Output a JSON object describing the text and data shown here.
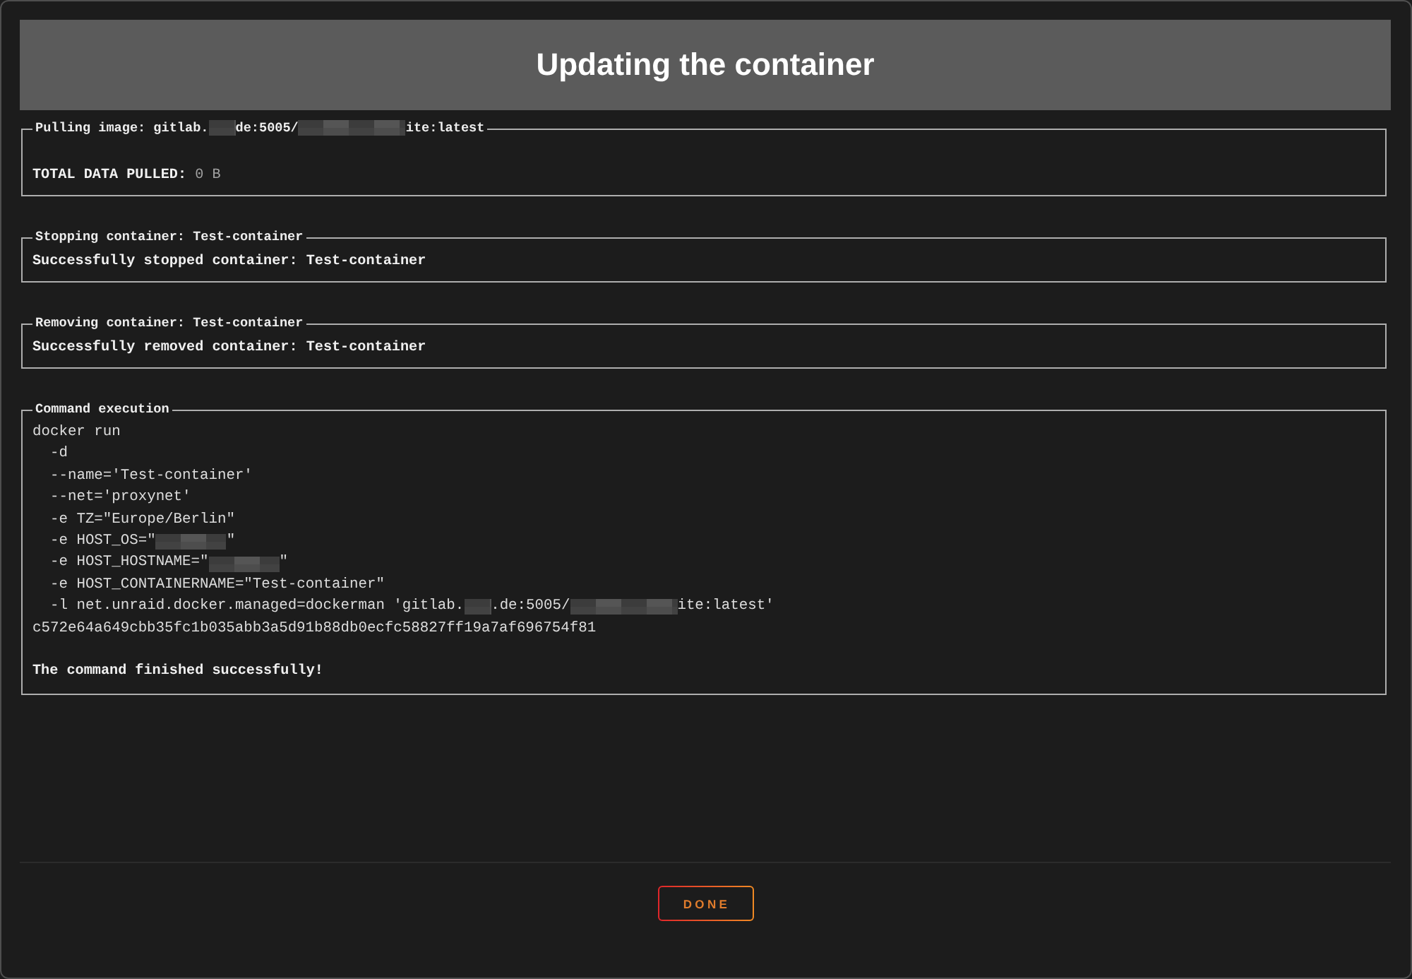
{
  "dialog": {
    "title": "Updating the container"
  },
  "sections": [
    {
      "legend": [
        {
          "kind": "text",
          "text": "Pulling image: gitlab."
        },
        {
          "kind": "shortmask"
        },
        {
          "kind": "text",
          "text": "de:5005/"
        },
        {
          "kind": "longmask"
        },
        {
          "kind": "text",
          "text": "ite:latest"
        }
      ],
      "lines": [
        {
          "kind": "data",
          "parts": [
            {
              "kind": "text",
              "text": "**TOTAL DATA PULLED:** 0 B"
            }
          ]
        }
      ]
    },
    {
      "legend": [
        {
          "kind": "text",
          "text": "Stopping container: Test-container"
        }
      ],
      "lines": [
        {
          "kind": "status",
          "parts": [
            {
              "kind": "text",
              "text": "Successfully stopped container: Test-container"
            }
          ]
        }
      ]
    },
    {
      "legend": [
        {
          "kind": "text",
          "text": "Removing container: Test-container"
        }
      ],
      "lines": [
        {
          "kind": "status",
          "parts": [
            {
              "kind": "text",
              "text": "Successfully removed container: Test-container"
            }
          ]
        }
      ]
    },
    {
      "legend": [
        {
          "kind": "text",
          "text": "Command execution"
        }
      ],
      "lines": [
        {
          "kind": "code",
          "parts": [
            {
              "kind": "text",
              "text": "docker run"
            }
          ],
          "children": [
            {
              "kind": "code",
              "parts": [
                {
                  "kind": "text",
                  "text": "-d"
                }
              ]
            },
            {
              "kind": "code",
              "parts": [
                {
                  "kind": "text",
                  "text": "--name='Test-container'"
                }
              ]
            },
            {
              "kind": "code",
              "parts": [
                {
                  "kind": "text",
                  "text": "--net='proxynet'"
                }
              ]
            },
            {
              "kind": "code",
              "parts": [
                {
                  "kind": "text",
                  "text": "-e TZ=\"Europe/Berlin\""
                }
              ]
            },
            {
              "kind": "code",
              "parts": [
                {
                  "kind": "text",
                  "text": "-e HOST_OS=\""
                },
                {
                  "kind": "mask"
                },
                {
                  "kind": "text",
                  "text": "\""
                }
              ]
            },
            {
              "kind": "code",
              "parts": [
                {
                  "kind": "text",
                  "text": "-e HOST_HOSTNAME=\""
                },
                {
                  "kind": "mask"
                },
                {
                  "kind": "text",
                  "text": "\""
                }
              ]
            },
            {
              "kind": "code",
              "parts": [
                {
                  "kind": "text",
                  "text": "-e HOST_CONTAINERNAME=\"Test-container\""
                }
              ]
            },
            {
              "kind": "code",
              "parts": [
                {
                  "kind": "text",
                  "text": "-l net.unraid.docker.managed=dockerman 'gitlab."
                },
                {
                  "kind": "shortmask"
                },
                {
                  "kind": "text",
                  "text": ".de:5005/"
                },
                {
                  "kind": "longmask"
                },
                {
                  "kind": "text",
                  "text": "ite:latest'"
                }
              ]
            }
          ]
        },
        {
          "kind": "code",
          "parts": [
            {
              "kind": "text",
              "text": "c572e64a649cbb35fc1b035abb3a5d91b88db0ecfc58827ff19a7af696754f81"
            }
          ]
        },
        {
          "kind": "result",
          "parts": [
            {
              "kind": "text",
              "text": "The command finished successfully!"
            }
          ]
        }
      ]
    }
  ],
  "button": {
    "label": "DONE"
  }
}
